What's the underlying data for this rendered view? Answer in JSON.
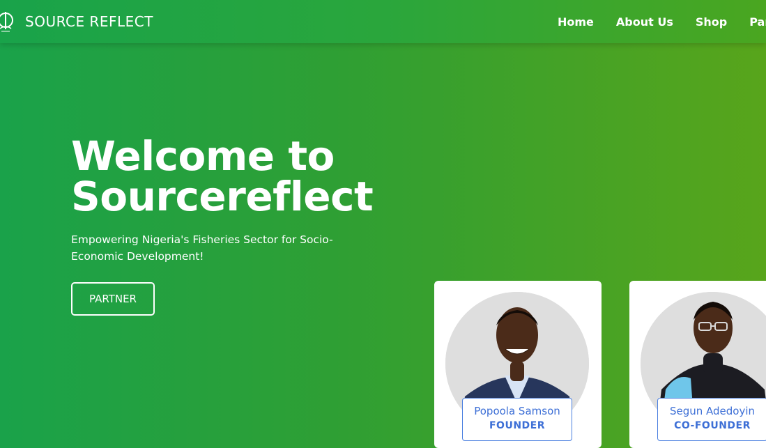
{
  "header": {
    "brand": "SOURCE REFLECT",
    "nav": [
      {
        "label": "Home"
      },
      {
        "label": "About Us"
      },
      {
        "label": "Shop"
      },
      {
        "label": "Partner"
      }
    ]
  },
  "hero": {
    "title_line1": "Welcome to",
    "title_line2": "Sourcereflect",
    "subtitle": "Empowering Nigeria's Fisheries Sector for Socio-Economic Development!",
    "cta_label": "PARTNER"
  },
  "team": [
    {
      "name": "Popoola Samson",
      "role": "FOUNDER"
    },
    {
      "name": "Segun Adedoyin",
      "role": "CO-FOUNDER"
    }
  ],
  "colors": {
    "brand_green": "#1aa24a",
    "accent_blue": "#3d6fd6",
    "text_light": "#ffffff"
  }
}
